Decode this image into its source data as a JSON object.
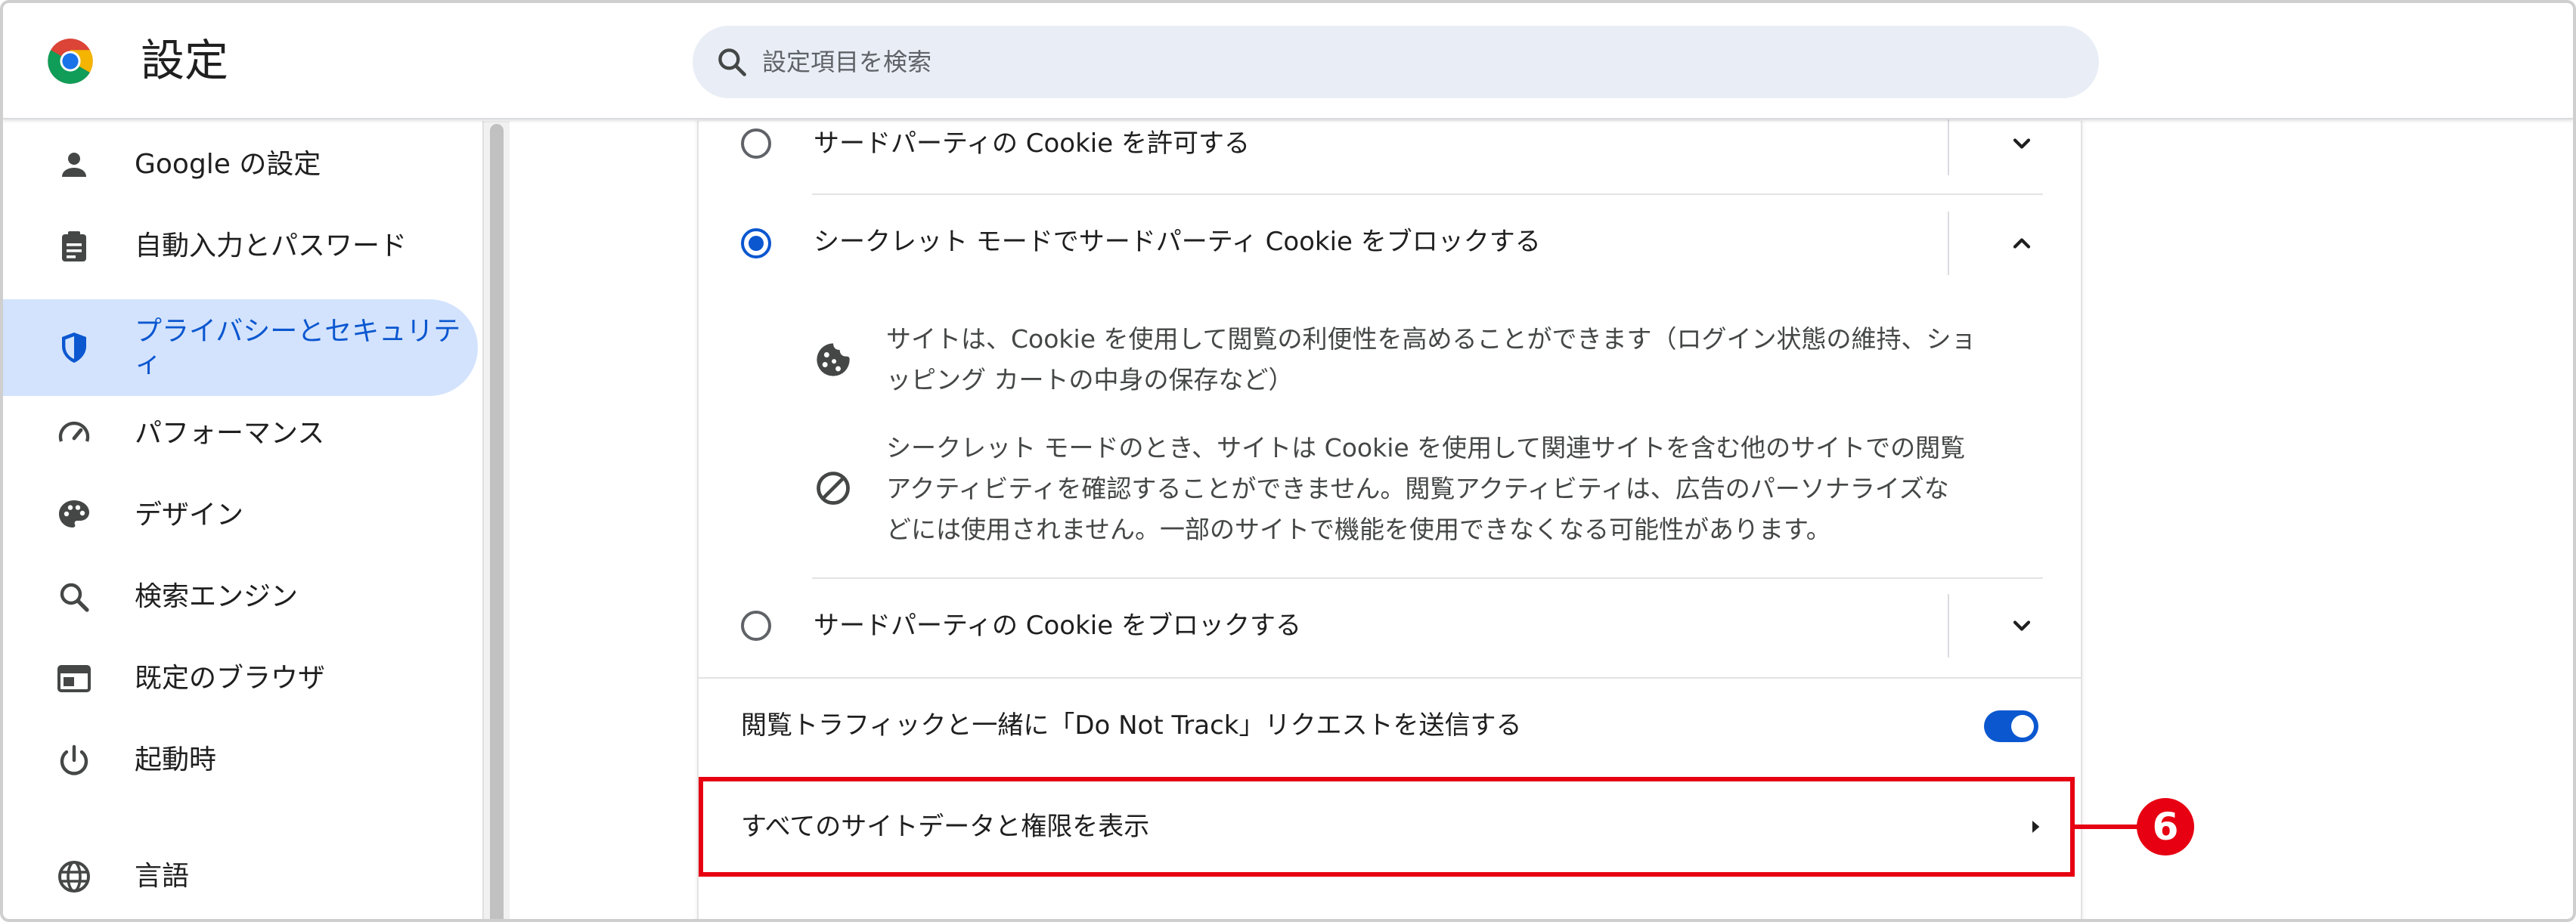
{
  "header": {
    "title": "設定",
    "search_placeholder": "設定項目を検索"
  },
  "sidebar": {
    "items": [
      {
        "label": "Google の設定",
        "icon": "person-icon"
      },
      {
        "label": "自動入力とパスワード",
        "icon": "clipboard-icon"
      },
      {
        "label": "プライバシーとセキュリティ",
        "icon": "shield-icon",
        "active": true
      },
      {
        "label": "パフォーマンス",
        "icon": "speedometer-icon"
      },
      {
        "label": "デザイン",
        "icon": "palette-icon"
      },
      {
        "label": "検索エンジン",
        "icon": "search-icon"
      },
      {
        "label": "既定のブラウザ",
        "icon": "browser-window-icon"
      },
      {
        "label": "起動時",
        "icon": "power-icon"
      },
      {
        "label": "言語",
        "icon": "globe-icon"
      }
    ],
    "active_label_line1": "プライバシーとセキュリテ",
    "active_label_line2": "ィ"
  },
  "main": {
    "options": [
      {
        "label": "サードパーティの Cookie を許可する",
        "checked": false,
        "expanded": false
      },
      {
        "label": "シークレット モードでサードパーティ Cookie をブロックする",
        "checked": true,
        "expanded": true
      },
      {
        "label": "サードパーティの Cookie をブロックする",
        "checked": false,
        "expanded": false
      }
    ],
    "details": [
      {
        "icon": "cookie-icon",
        "line1": "サイトは、Cookie を使用して閲覧の利便性を高めることができます（ログイン状態の維持、ショ",
        "line2": "ッピング カートの中身の保存など）"
      },
      {
        "icon": "blocked-icon",
        "line1": "シークレット モードのとき、サイトは Cookie を使用して関連サイトを含む他のサイトでの閲覧",
        "line2": "アクティビティを確認することができません。閲覧アクティビティは、広告のパーソナライズな",
        "line3": "どには使用されません。一部のサイトで機能を使用できなくなる可能性があります。"
      }
    ],
    "do_not_track_label": "閲覧トラフィックと一緒に「Do Not Track」リクエストを送信する",
    "do_not_track_on": true,
    "site_data_label": "すべてのサイトデータと権限を表示",
    "callout_number": "6"
  },
  "colors": {
    "accent": "#0b57d0",
    "active_bg": "#d3e3fd",
    "highlight": "#e60012",
    "search_bg": "#e9eef6"
  }
}
